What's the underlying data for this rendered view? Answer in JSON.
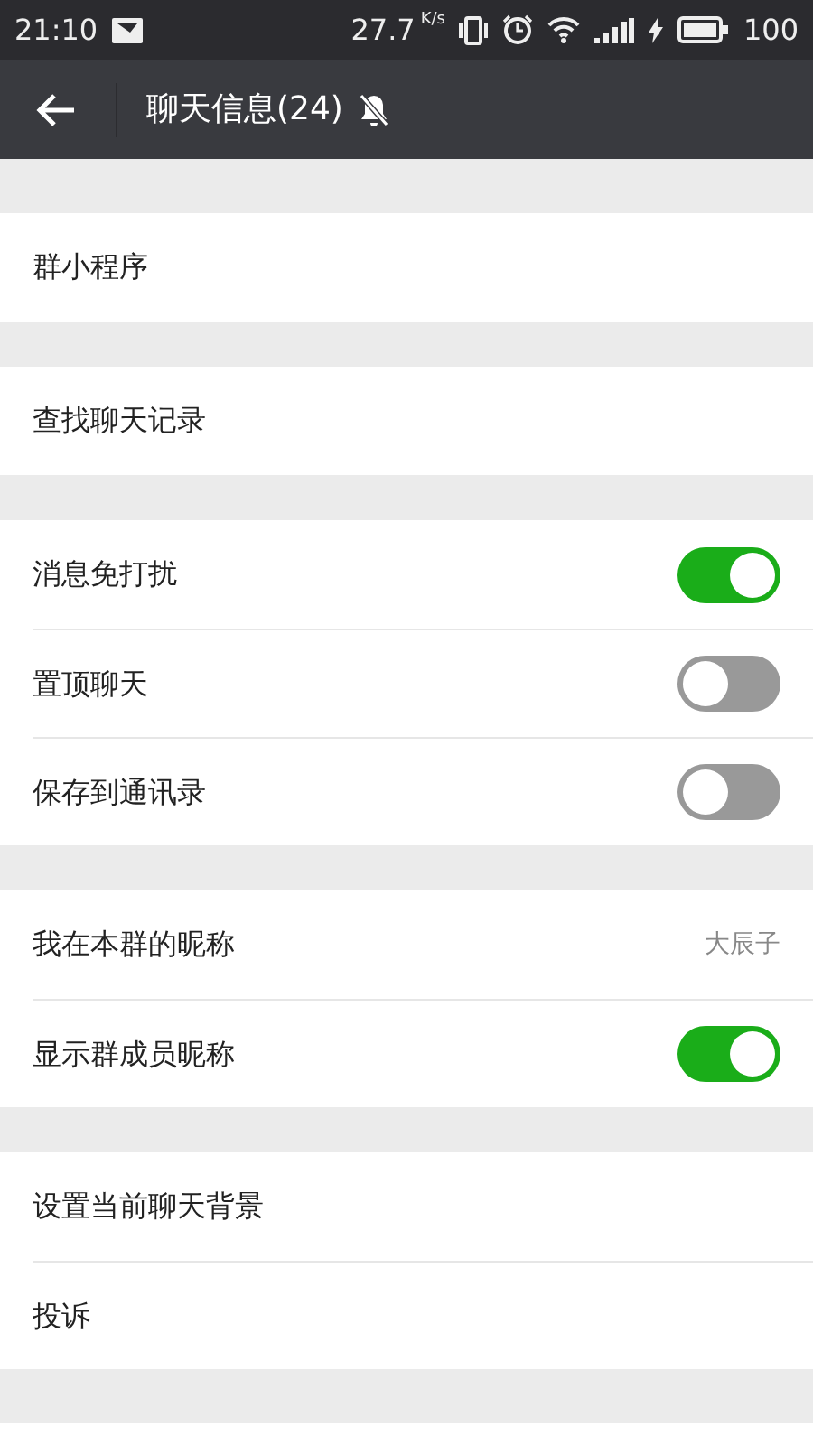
{
  "status_bar": {
    "time": "21:10",
    "speed": "27.7",
    "speed_unit": "K/s",
    "battery": "100"
  },
  "header": {
    "title": "聊天信息(24)",
    "muted": true
  },
  "groups": [
    {
      "items": [
        {
          "kind": "link",
          "label": "群小程序"
        }
      ]
    },
    {
      "items": [
        {
          "kind": "link",
          "label": "查找聊天记录"
        }
      ]
    },
    {
      "items": [
        {
          "kind": "toggle",
          "label": "消息免打扰",
          "on": true
        },
        {
          "kind": "toggle",
          "label": "置顶聊天",
          "on": false
        },
        {
          "kind": "toggle",
          "label": "保存到通讯录",
          "on": false
        }
      ]
    },
    {
      "items": [
        {
          "kind": "value",
          "label": "我在本群的昵称",
          "value": "大辰子"
        },
        {
          "kind": "toggle",
          "label": "显示群成员昵称",
          "on": true
        }
      ]
    },
    {
      "items": [
        {
          "kind": "link",
          "label": "设置当前聊天背景"
        },
        {
          "kind": "link",
          "label": "投诉"
        }
      ]
    }
  ]
}
